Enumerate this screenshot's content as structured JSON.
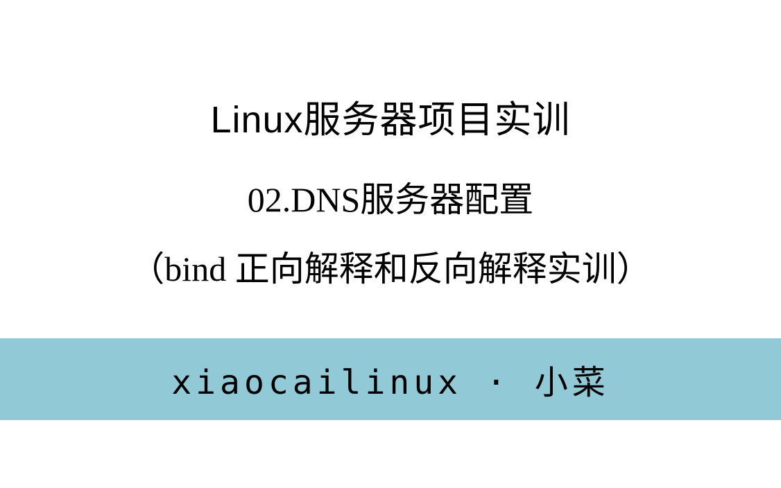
{
  "title": "Linux服务器项目实训",
  "subtitle_line1": "02.DNS服务器配置",
  "subtitle_line2": "（bind 正向解释和反向解释实训）",
  "footer": "xiaocailinux · 小菜"
}
